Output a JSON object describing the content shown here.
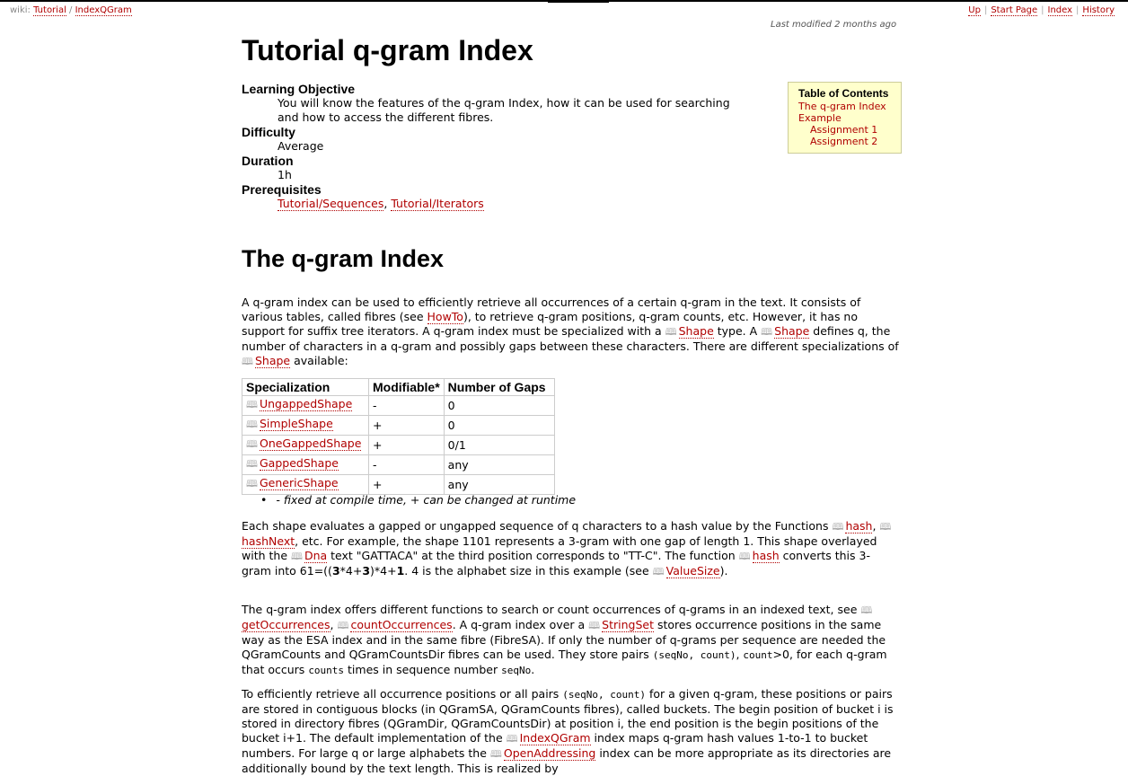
{
  "breadcrumb": {
    "prefix": "wiki:",
    "item1": "Tutorial",
    "sep": "/",
    "item2": "IndexQGram"
  },
  "topnav": {
    "up": "Up",
    "start_page": "Start Page",
    "index": "Index",
    "history": "History"
  },
  "last_modified": "Last modified 2 months ago",
  "title": "Tutorial q-gram Index",
  "toc": {
    "title": "Table of Contents",
    "item1": "The q-gram Index",
    "item2": "Example",
    "item3": "Assignment 1",
    "item4": "Assignment 2"
  },
  "meta": {
    "objective_label": "Learning Objective",
    "objective_text": "You will know the features of the q-gram Index, how it can be used for searching and how to access the different fibres.",
    "difficulty_label": "Difficulty",
    "difficulty_value": "Average",
    "duration_label": "Duration",
    "duration_value": "1h",
    "prereq_label": "Prerequisites",
    "prereq_link1": "Tutorial/Sequences",
    "prereq_sep": ",",
    "prereq_link2": "Tutorial/Iterators"
  },
  "section_title": "The q-gram Index",
  "p1": {
    "t1": "A q-gram index can be used to efficiently retrieve all occurrences of a certain q-gram in the text. It consists of various tables, called fibres (see ",
    "l1": "HowTo",
    "t2": "), to retrieve q-gram positions, q-gram counts, etc. However, it has no support for suffix tree iterators. A q-gram index must be specialized with a ",
    "l2": "Shape",
    "t3": " type. A ",
    "l3": "Shape",
    "t4": " defines q, the number of characters in a q-gram and possibly gaps between these characters. There are different specializations of ",
    "l4": "Shape",
    "t5": " available:"
  },
  "table": {
    "headers": [
      "Specialization",
      "Modifiable*",
      "Number of Gaps"
    ],
    "rows": [
      [
        "UngappedShape",
        "-",
        "0"
      ],
      [
        "SimpleShape",
        "+",
        "0"
      ],
      [
        "OneGappedShape",
        "+",
        "0/1"
      ],
      [
        "GappedShape",
        "-",
        "any"
      ],
      [
        "GenericShape",
        "+",
        "any"
      ]
    ]
  },
  "bullet_text": "- fixed at compile time, + can be changed at runtime",
  "p2": {
    "t1": "Each shape evaluates a gapped or ungapped sequence of q characters to a hash value by the Functions ",
    "l1": "hash",
    "t2": ", ",
    "l2": "hashNext",
    "t3": ", etc. For example, the shape 1101 represents a 3-gram with one gap of length 1. This shape overlayed with the ",
    "l3": "Dna",
    "t4": " text \"GATTACA\" at the third position corresponds to \"TT-C\". The function ",
    "l4": "hash",
    "t5": " converts this 3-gram into 61=((",
    "b1": "3",
    "t6": "*4+",
    "b2": "3",
    "t7": ")*4+",
    "b3": "1",
    "t8": ". 4 is the alphabet size in this example (see ",
    "l5": "ValueSize",
    "t9": ")."
  },
  "p3": {
    "t1": "The q-gram index offers different functions to search or count occurrences of q-grams in an indexed text, see ",
    "l1": "getOccurrences",
    "t2": ", ",
    "l2": "countOccurrences",
    "t3": ". A q-gram index over a ",
    "l3": "StringSet",
    "t4": " stores occurrence positions in the same way as the ESA index and in the same fibre (FibreSA). If only the number of q-grams per sequence are needed the QGramCounts and QGramCountsDir fibres can be used. They store pairs ",
    "c1": "(seqNo, count)",
    "t5": ", ",
    "c2": "count",
    "t6": ">0, for each q-gram that occurs ",
    "c3": "counts",
    "t7": " times in sequence number ",
    "c4": "seqNo",
    "t8": "."
  },
  "p4": {
    "t1": "To efficiently retrieve all occurrence positions or all pairs ",
    "c1": "(seqNo, count)",
    "t2": " for a given q-gram, these positions or pairs are stored in contiguous blocks (in QGramSA, QGramCounts fibres), called buckets. The begin position of bucket i is stored in directory fibres (QGramDir, QGramCountsDir) at position i, the end position is the begin positions of the bucket i+1. The default implementation of the ",
    "l1": "IndexQGram",
    "t3": " index maps q-gram hash values 1-to-1 to bucket numbers. For large q or large alphabets the ",
    "l2": "OpenAddressing",
    "t4": " index can be more appropriate as its directories are additionally bound by the text length. This is realized by"
  }
}
